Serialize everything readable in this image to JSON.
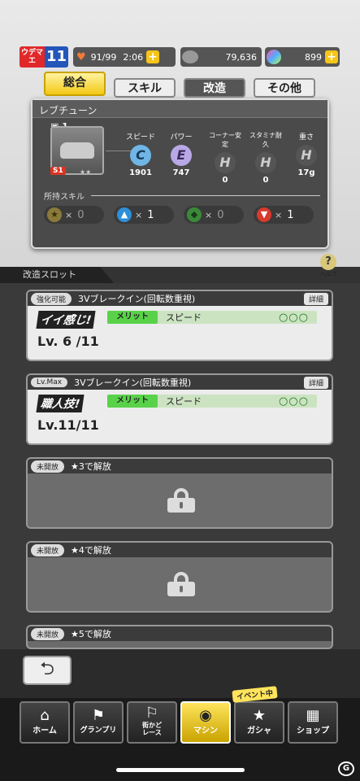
{
  "status": {
    "rank_label": "ウデマエ",
    "rank_value": "11",
    "stamina": "91/99",
    "timer": "2:06",
    "coins": "79,636",
    "gems": "899",
    "plus": "+"
  },
  "tabs": [
    {
      "label": "総合",
      "active": true
    },
    {
      "label": "スキル"
    },
    {
      "label": "改造"
    },
    {
      "label": "その他"
    }
  ],
  "panel": {
    "title": "レブチューン",
    "car_level": "1",
    "car_class": "S1",
    "car_stars": "★★",
    "stats": [
      {
        "label": "スピード",
        "grade": "C",
        "value": "1901",
        "color": "#6fb6e6"
      },
      {
        "label": "パワー",
        "grade": "E",
        "value": "747",
        "color": "#b8a8e6"
      },
      {
        "label": "コーナー安定",
        "grade": "H",
        "value": "0",
        "color": "#555555"
      },
      {
        "label": "スタミナ耐久",
        "grade": "H",
        "value": "0",
        "color": "#555555"
      },
      {
        "label": "重さ",
        "grade": "H",
        "value": "17g",
        "color": "#555555"
      }
    ],
    "skills_label": "所持スキル",
    "skills": [
      {
        "icon": "star-icon",
        "count": "0",
        "color": "#8a7a3a",
        "sym": "★"
      },
      {
        "icon": "arrow-up-icon",
        "count": "1",
        "color": "#2d8fd8",
        "sym": "▲"
      },
      {
        "icon": "diamond-icon",
        "count": "0",
        "color": "#3a8a3a",
        "sym": "◆"
      },
      {
        "icon": "arrow-down-icon",
        "count": "1",
        "color": "#d83a2d",
        "sym": "▼"
      }
    ],
    "x": "×"
  },
  "slot_section_label": "改造スロット",
  "help_label": "ヘルプ",
  "cards": [
    {
      "tag": "強化可能",
      "name": "3Vブレークイン(回転数重視)",
      "detail": "詳細",
      "badge": "イイ感じ!",
      "level": "Lv. 6 /11",
      "merit": "メリット",
      "stat": "スピード",
      "marks": "○○○"
    },
    {
      "tag": "Lv.Max",
      "name": "3Vブレークイン(回転数重視)",
      "detail": "詳細",
      "badge": "職人技!",
      "level": "Lv.11/11",
      "merit": "メリット",
      "stat": "スピード",
      "marks": "○○○"
    }
  ],
  "locked": [
    {
      "tag": "未開放",
      "text": "★3で解放"
    },
    {
      "tag": "未開放",
      "text": "★4で解放"
    },
    {
      "tag": "未開放",
      "text": "★5で解放"
    }
  ],
  "back_symbol": "⮌",
  "event_tag": "イベント中",
  "nav": [
    {
      "label": "ホーム",
      "icon": "toolbox-icon",
      "sym": "⌂"
    },
    {
      "label": "グランプリ",
      "icon": "checkered-flag-icon",
      "sym": "⚑"
    },
    {
      "label": "街かど\nレース",
      "icon": "runners-icon",
      "sym": "⚐"
    },
    {
      "label": "マシン",
      "icon": "car-icon",
      "sym": "◉",
      "active": true
    },
    {
      "label": "ガシャ",
      "icon": "star-laurel-icon",
      "sym": "★"
    },
    {
      "label": "ショップ",
      "icon": "store-icon",
      "sym": "▦"
    }
  ],
  "watermark": "G"
}
